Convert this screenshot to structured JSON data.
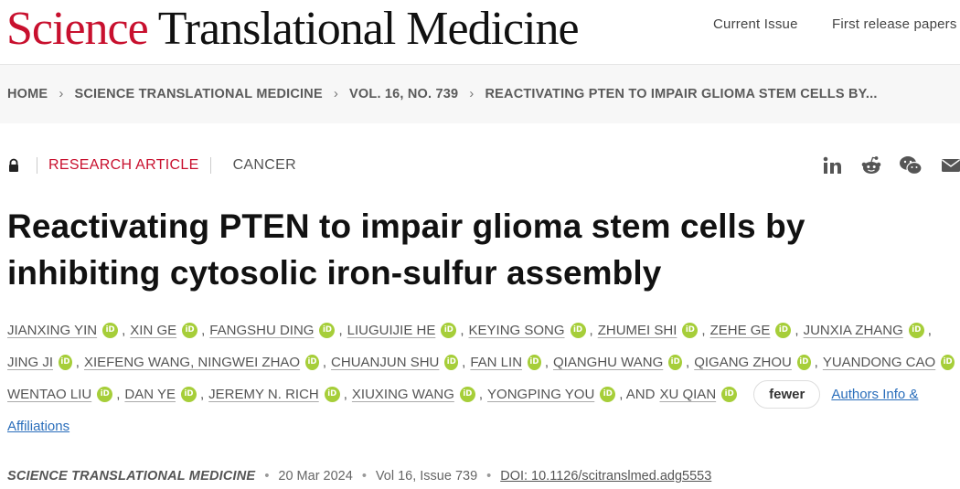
{
  "header": {
    "brand_science": "Science",
    "brand_rest": "Translational Medicine",
    "nav_current": "Current Issue",
    "nav_first": "First release papers"
  },
  "breadcrumb": [
    "HOME",
    "SCIENCE TRANSLATIONAL MEDICINE",
    "VOL. 16, NO. 739",
    "REACTIVATING PTEN TO IMPAIR GLIOMA STEM CELLS BY..."
  ],
  "article": {
    "type": "RESEARCH ARTICLE",
    "subject": "CANCER",
    "title": "Reactivating PTEN to impair glioma stem cells by inhibiting cytosolic iron-sulfur assembly"
  },
  "share_icons": [
    "linkedin-icon",
    "reddit-icon",
    "wechat-icon",
    "email-icon"
  ],
  "authors": {
    "line1": [
      "JIANXING YIN",
      "XIN GE",
      "FANGSHU DING",
      "LIUGUIJIE HE",
      "KEYING SONG",
      "ZHUMEI SHI",
      "ZEHE GE",
      "JUNXIA ZHANG"
    ],
    "line2": [
      "JING JI",
      "XIEFENG WANG, NINGWEI ZHAO",
      "CHUANJUN SHU",
      "FAN LIN",
      "QIANGHU WANG",
      "QIGANG ZHOU",
      "YUANDONG CAO"
    ],
    "line3": [
      "WENTAO LIU",
      "DAN YE",
      "JEREMY N. RICH",
      "XIUXING WANG",
      "YONGPING YOU"
    ],
    "and_text": ", AND",
    "last": "XU QIAN",
    "fewer_label": "fewer",
    "affil_label_1": "Authors Info &",
    "affil_label_2": "Affiliations",
    "orcid_text": "iD"
  },
  "citation": {
    "journal": "SCIENCE TRANSLATIONAL MEDICINE",
    "date": "20 Mar 2024",
    "volume": "Vol 16, Issue 739",
    "doi": "DOI: 10.1126/scitranslmed.adg5553"
  },
  "colors": {
    "brand_red": "#c8102e",
    "orcid_green": "#a6ce39",
    "link_blue": "#2a6ebb"
  }
}
